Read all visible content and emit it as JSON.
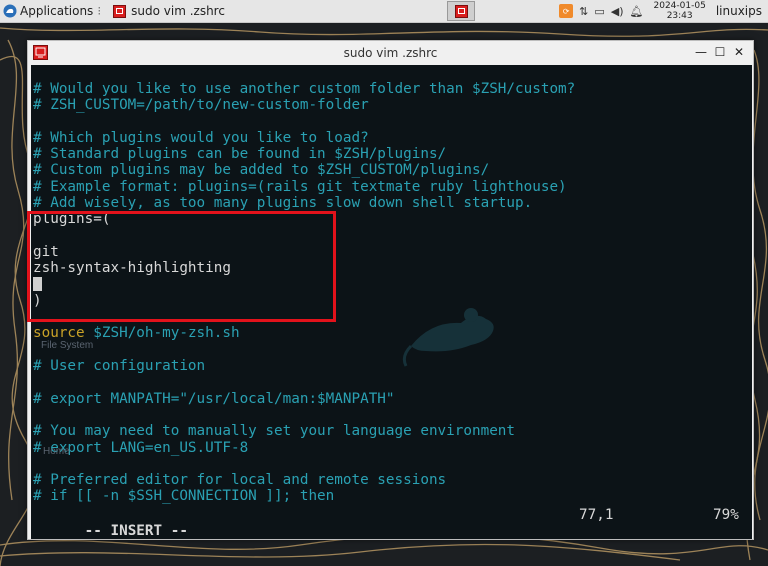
{
  "panel": {
    "applications_label": "Applications",
    "task_title": "sudo vim .zshrc",
    "clock_date": "2024-01-05",
    "clock_time": "23:43",
    "user": "linuxips"
  },
  "window": {
    "title": "sudo vim .zshrc"
  },
  "editor": {
    "lines": [
      {
        "cls": "comment",
        "text": "# Would you like to use another custom folder than $ZSH/custom?"
      },
      {
        "cls": "comment",
        "text": "# ZSH_CUSTOM=/path/to/new-custom-folder"
      },
      {
        "cls": "comment",
        "text": ""
      },
      {
        "cls": "comment",
        "text": "# Which plugins would you like to load?"
      },
      {
        "cls": "comment",
        "text": "# Standard plugins can be found in $ZSH/plugins/"
      },
      {
        "cls": "comment",
        "text": "# Custom plugins may be added to $ZSH_CUSTOM/plugins/"
      },
      {
        "cls": "comment",
        "text": "# Example format: plugins=(rails git textmate ruby lighthouse)"
      },
      {
        "cls": "comment",
        "text": "# Add wisely, as too many plugins slow down shell startup."
      },
      {
        "cls": "normal",
        "text": "plugins=("
      },
      {
        "cls": "normal",
        "text": ""
      },
      {
        "cls": "normal",
        "text": "git"
      },
      {
        "cls": "normal",
        "text": "zsh-syntax-highlighting"
      },
      {
        "cls": "cursor",
        "text": ""
      },
      {
        "cls": "normal",
        "text": ")"
      },
      {
        "cls": "normal",
        "text": ""
      },
      {
        "cls": "source",
        "text": "source",
        "rest": " $ZSH/oh-my-zsh.sh"
      },
      {
        "cls": "normal",
        "text": ""
      },
      {
        "cls": "comment",
        "text": "# User configuration"
      },
      {
        "cls": "normal",
        "text": ""
      },
      {
        "cls": "comment",
        "text": "# export MANPATH=\"/usr/local/man:$MANPATH\""
      },
      {
        "cls": "normal",
        "text": ""
      },
      {
        "cls": "comment",
        "text": "# You may need to manually set your language environment"
      },
      {
        "cls": "comment",
        "text": "# export LANG=en_US.UTF-8"
      },
      {
        "cls": "normal",
        "text": ""
      },
      {
        "cls": "comment",
        "text": "# Preferred editor for local and remote sessions"
      },
      {
        "cls": "comment",
        "text": "# if [[ -n $SSH_CONNECTION ]]; then"
      }
    ],
    "mode": "-- INSERT --",
    "position": "77,1",
    "percent": "79%"
  },
  "desktop_labels": {
    "file_system": "File System",
    "home": "Home"
  },
  "colors": {
    "comment": "#2aa1b3",
    "keyword": "#c9a227",
    "highlight_box": "#e3121b",
    "terminal_bg": "#0c1317"
  }
}
